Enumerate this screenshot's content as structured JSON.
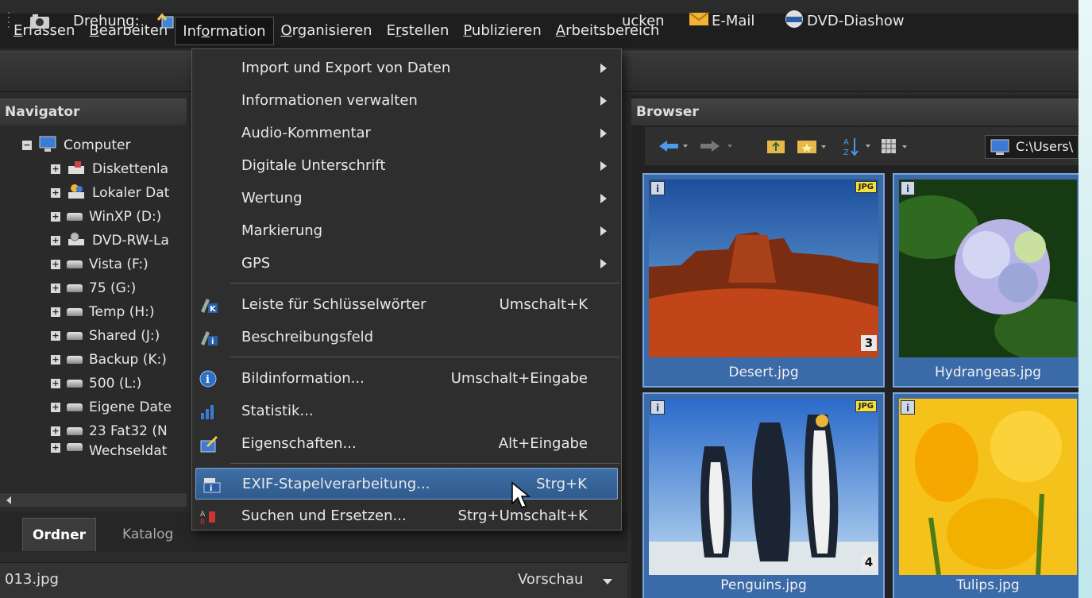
{
  "menubar": {
    "items": [
      {
        "u": "E",
        "rest": "rfassen"
      },
      {
        "u": "B",
        "rest": "earbeiten"
      },
      {
        "pre": "Inf",
        "u": "o",
        "rest": "rmation"
      },
      {
        "u": "O",
        "rest": "rganisieren"
      },
      {
        "pre": "E",
        "u": "r",
        "rest": "stellen"
      },
      {
        "u": "P",
        "rest": "ublizieren"
      },
      {
        "u": "A",
        "rest": "rbeitsbereich"
      }
    ]
  },
  "toolbar": {
    "rotation_label": "Drehung:",
    "print_label": "ucken",
    "email_label": "E-Mail",
    "dvd_label": "DVD-Diashow"
  },
  "navigator": {
    "title": "Navigator",
    "root": "Computer",
    "items": [
      "Diskettenla",
      "Lokaler Dat",
      "WinXP (D:)",
      "DVD-RW-La",
      "Vista (F:)",
      "75 (G:)",
      "Temp (H:)",
      "Shared (J:)",
      "Backup (K:)",
      "500 (L:)",
      "Eigene Date",
      "23 Fat32 (N",
      "Wechseldat"
    ],
    "tabs": [
      "Ordner",
      "Katalog"
    ]
  },
  "status": {
    "filename": "013.jpg",
    "preview_label": "Vorschau"
  },
  "browser": {
    "title": "Browser",
    "path": "C:\\Users\\",
    "thumbnails": [
      {
        "name": "Desert.jpg",
        "badge_number": "3",
        "jpg": "JPG"
      },
      {
        "name": "Hydrangeas.jpg"
      },
      {
        "name": "Penguins.jpg",
        "badge_number": "4",
        "jpg": "JPG"
      },
      {
        "name": "Tulips.jpg"
      }
    ]
  },
  "dropdown": {
    "submenus": [
      "Import und Export von Daten",
      "Informationen verwalten",
      "Audio-Kommentar",
      "Digitale Unterschrift",
      "Wertung",
      "Markierung",
      "GPS"
    ],
    "group2": [
      {
        "label": "Leiste für Schlüsselwörter",
        "shortcut": "Umschalt+K"
      },
      {
        "label": "Beschreibungsfeld",
        "shortcut": ""
      }
    ],
    "group3": [
      {
        "label": "Bildinformation...",
        "shortcut": "Umschalt+Eingabe"
      },
      {
        "label": "Statistik...",
        "shortcut": ""
      },
      {
        "label": "Eigenschaften...",
        "shortcut": "Alt+Eingabe"
      }
    ],
    "group4": [
      {
        "label": "EXIF-Stapelverarbeitung...",
        "shortcut": "Strg+K"
      },
      {
        "label": "Suchen und Ersetzen...",
        "shortcut": "Strg+Umschalt+K"
      }
    ]
  },
  "colors": {
    "highlight": "#3f6fa6",
    "thumb_bg": "#3b6aa8",
    "email_icon": "#f2b233"
  }
}
